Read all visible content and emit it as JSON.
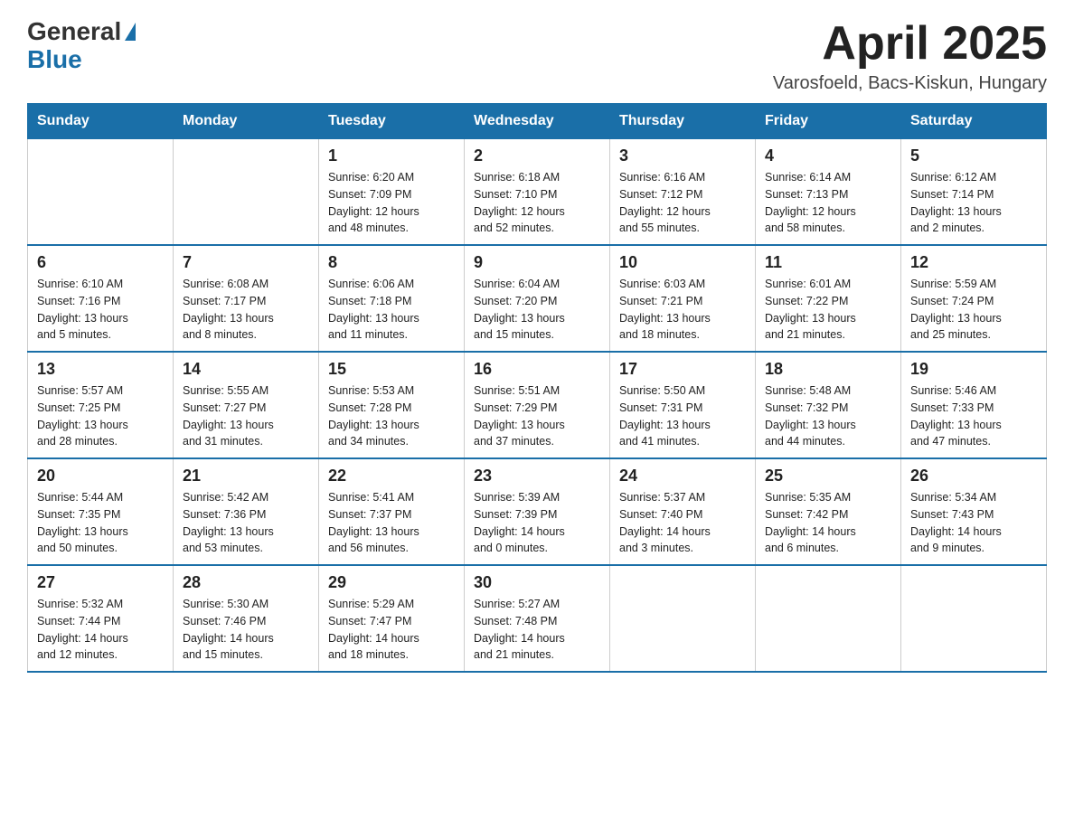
{
  "header": {
    "logo_general": "General",
    "logo_blue": "Blue",
    "title": "April 2025",
    "subtitle": "Varosfoeld, Bacs-Kiskun, Hungary"
  },
  "weekdays": [
    "Sunday",
    "Monday",
    "Tuesday",
    "Wednesday",
    "Thursday",
    "Friday",
    "Saturday"
  ],
  "weeks": [
    [
      {
        "day": "",
        "info": ""
      },
      {
        "day": "",
        "info": ""
      },
      {
        "day": "1",
        "info": "Sunrise: 6:20 AM\nSunset: 7:09 PM\nDaylight: 12 hours\nand 48 minutes."
      },
      {
        "day": "2",
        "info": "Sunrise: 6:18 AM\nSunset: 7:10 PM\nDaylight: 12 hours\nand 52 minutes."
      },
      {
        "day": "3",
        "info": "Sunrise: 6:16 AM\nSunset: 7:12 PM\nDaylight: 12 hours\nand 55 minutes."
      },
      {
        "day": "4",
        "info": "Sunrise: 6:14 AM\nSunset: 7:13 PM\nDaylight: 12 hours\nand 58 minutes."
      },
      {
        "day": "5",
        "info": "Sunrise: 6:12 AM\nSunset: 7:14 PM\nDaylight: 13 hours\nand 2 minutes."
      }
    ],
    [
      {
        "day": "6",
        "info": "Sunrise: 6:10 AM\nSunset: 7:16 PM\nDaylight: 13 hours\nand 5 minutes."
      },
      {
        "day": "7",
        "info": "Sunrise: 6:08 AM\nSunset: 7:17 PM\nDaylight: 13 hours\nand 8 minutes."
      },
      {
        "day": "8",
        "info": "Sunrise: 6:06 AM\nSunset: 7:18 PM\nDaylight: 13 hours\nand 11 minutes."
      },
      {
        "day": "9",
        "info": "Sunrise: 6:04 AM\nSunset: 7:20 PM\nDaylight: 13 hours\nand 15 minutes."
      },
      {
        "day": "10",
        "info": "Sunrise: 6:03 AM\nSunset: 7:21 PM\nDaylight: 13 hours\nand 18 minutes."
      },
      {
        "day": "11",
        "info": "Sunrise: 6:01 AM\nSunset: 7:22 PM\nDaylight: 13 hours\nand 21 minutes."
      },
      {
        "day": "12",
        "info": "Sunrise: 5:59 AM\nSunset: 7:24 PM\nDaylight: 13 hours\nand 25 minutes."
      }
    ],
    [
      {
        "day": "13",
        "info": "Sunrise: 5:57 AM\nSunset: 7:25 PM\nDaylight: 13 hours\nand 28 minutes."
      },
      {
        "day": "14",
        "info": "Sunrise: 5:55 AM\nSunset: 7:27 PM\nDaylight: 13 hours\nand 31 minutes."
      },
      {
        "day": "15",
        "info": "Sunrise: 5:53 AM\nSunset: 7:28 PM\nDaylight: 13 hours\nand 34 minutes."
      },
      {
        "day": "16",
        "info": "Sunrise: 5:51 AM\nSunset: 7:29 PM\nDaylight: 13 hours\nand 37 minutes."
      },
      {
        "day": "17",
        "info": "Sunrise: 5:50 AM\nSunset: 7:31 PM\nDaylight: 13 hours\nand 41 minutes."
      },
      {
        "day": "18",
        "info": "Sunrise: 5:48 AM\nSunset: 7:32 PM\nDaylight: 13 hours\nand 44 minutes."
      },
      {
        "day": "19",
        "info": "Sunrise: 5:46 AM\nSunset: 7:33 PM\nDaylight: 13 hours\nand 47 minutes."
      }
    ],
    [
      {
        "day": "20",
        "info": "Sunrise: 5:44 AM\nSunset: 7:35 PM\nDaylight: 13 hours\nand 50 minutes."
      },
      {
        "day": "21",
        "info": "Sunrise: 5:42 AM\nSunset: 7:36 PM\nDaylight: 13 hours\nand 53 minutes."
      },
      {
        "day": "22",
        "info": "Sunrise: 5:41 AM\nSunset: 7:37 PM\nDaylight: 13 hours\nand 56 minutes."
      },
      {
        "day": "23",
        "info": "Sunrise: 5:39 AM\nSunset: 7:39 PM\nDaylight: 14 hours\nand 0 minutes."
      },
      {
        "day": "24",
        "info": "Sunrise: 5:37 AM\nSunset: 7:40 PM\nDaylight: 14 hours\nand 3 minutes."
      },
      {
        "day": "25",
        "info": "Sunrise: 5:35 AM\nSunset: 7:42 PM\nDaylight: 14 hours\nand 6 minutes."
      },
      {
        "day": "26",
        "info": "Sunrise: 5:34 AM\nSunset: 7:43 PM\nDaylight: 14 hours\nand 9 minutes."
      }
    ],
    [
      {
        "day": "27",
        "info": "Sunrise: 5:32 AM\nSunset: 7:44 PM\nDaylight: 14 hours\nand 12 minutes."
      },
      {
        "day": "28",
        "info": "Sunrise: 5:30 AM\nSunset: 7:46 PM\nDaylight: 14 hours\nand 15 minutes."
      },
      {
        "day": "29",
        "info": "Sunrise: 5:29 AM\nSunset: 7:47 PM\nDaylight: 14 hours\nand 18 minutes."
      },
      {
        "day": "30",
        "info": "Sunrise: 5:27 AM\nSunset: 7:48 PM\nDaylight: 14 hours\nand 21 minutes."
      },
      {
        "day": "",
        "info": ""
      },
      {
        "day": "",
        "info": ""
      },
      {
        "day": "",
        "info": ""
      }
    ]
  ]
}
